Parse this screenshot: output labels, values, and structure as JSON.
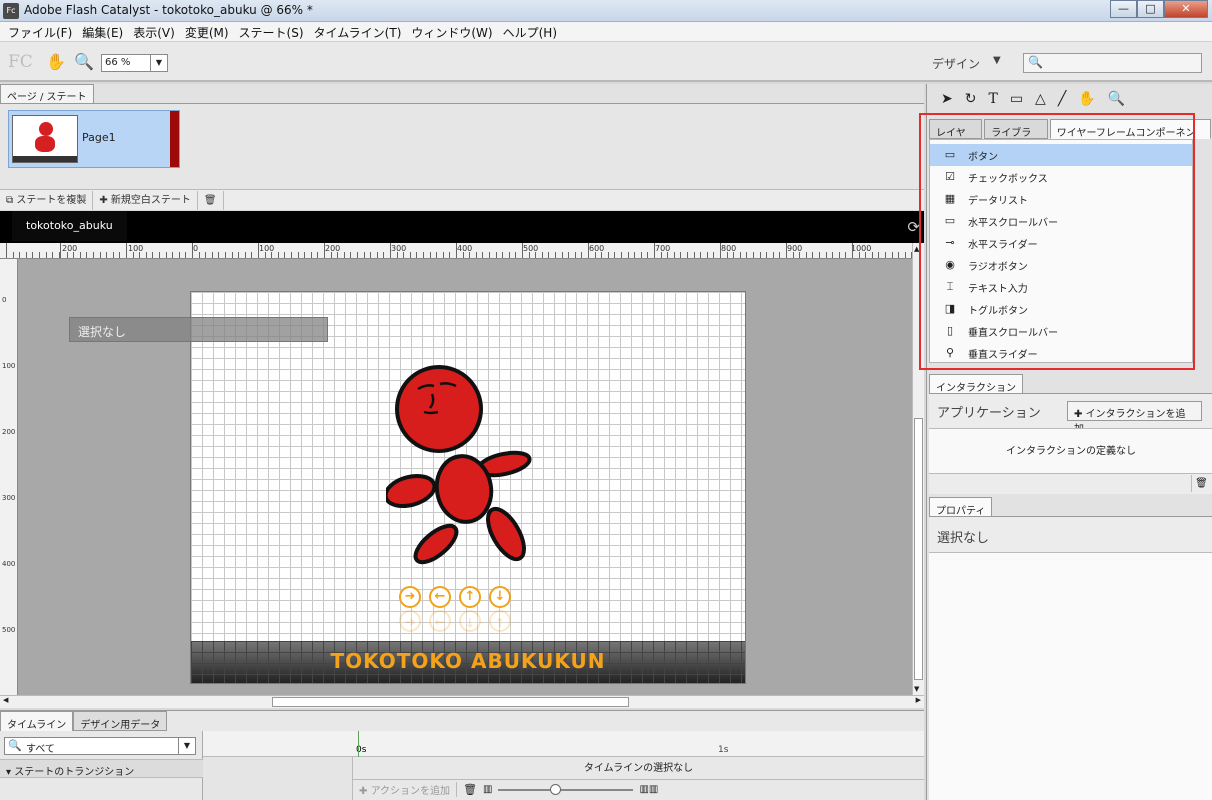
{
  "window": {
    "title": "Adobe Flash Catalyst - tokotoko_abuku @ 66% *",
    "app_icon": "Fc",
    "minimize": "—",
    "maximize": "□",
    "close": "✕"
  },
  "menu": [
    "ファイル(F)",
    "編集(E)",
    "表示(V)",
    "変更(M)",
    "ステート(S)",
    "タイムライン(T)",
    "ウィンドウ(W)",
    "ヘルプ(H)"
  ],
  "toolbar": {
    "logo": "FC",
    "zoom": "66 %",
    "workspace": "デザイン",
    "search_placeholder": ""
  },
  "pages": {
    "tab": "ページ / ステート",
    "items": [
      {
        "label": "Page1"
      }
    ],
    "duplicate": "ステートを複製",
    "new_blank": "新規空白ステート"
  },
  "document": {
    "tab": "tokotoko_abuku",
    "ruler_labels": [
      "200",
      "100",
      "0",
      "100",
      "200",
      "300",
      "400",
      "500",
      "600",
      "700",
      "800",
      "900",
      "1000"
    ],
    "vruler_labels": [
      "0",
      "100",
      "200",
      "300",
      "400",
      "500"
    ],
    "selection_label": "選択なし",
    "banner": "TOKOTOKO ABUKUKUN",
    "arrow_buttons": [
      "➜",
      "←",
      "↑",
      "↓"
    ]
  },
  "timeline": {
    "tabs": [
      "タイムライン",
      "デザイン用データ"
    ],
    "filter": "すべて",
    "transitions": "ステートのトランジション",
    "t0": "0s",
    "t1": "1s",
    "no_selection": "タイムラインの選択なし",
    "add_action": "アクションを追加"
  },
  "tools": [
    "selection-arrow",
    "rotate",
    "text",
    "rectangle",
    "triangle",
    "line",
    "hand",
    "zoom"
  ],
  "components": {
    "tabs": [
      "レイヤー",
      "ライブラリ",
      "ワイヤーフレームコンポーネント"
    ],
    "items": [
      {
        "label": "ボタン",
        "icon": "button-icon",
        "glyph": "▭"
      },
      {
        "label": "チェックボックス",
        "icon": "checkbox-icon",
        "glyph": "☑"
      },
      {
        "label": "データリスト",
        "icon": "datalist-icon",
        "glyph": "▦"
      },
      {
        "label": "水平スクロールバー",
        "icon": "hscrollbar-icon",
        "glyph": "▭"
      },
      {
        "label": "水平スライダー",
        "icon": "hslider-icon",
        "glyph": "⊸"
      },
      {
        "label": "ラジオボタン",
        "icon": "radio-icon",
        "glyph": "◉"
      },
      {
        "label": "テキスト入力",
        "icon": "textinput-icon",
        "glyph": "⌶"
      },
      {
        "label": "トグルボタン",
        "icon": "toggle-icon",
        "glyph": "◨"
      },
      {
        "label": "垂直スクロールバー",
        "icon": "vscrollbar-icon",
        "glyph": "▯"
      },
      {
        "label": "垂直スライダー",
        "icon": "vslider-icon",
        "glyph": "⚲"
      }
    ],
    "highlight_color": "#e42c2c",
    "selected_color": "#b4d2f6"
  },
  "interactions": {
    "tab": "インタラクション",
    "scope": "アプリケーション",
    "add": "インタラクションを追加",
    "empty": "インタラクションの定義なし"
  },
  "properties": {
    "tab": "プロパティ",
    "status": "選択なし"
  }
}
